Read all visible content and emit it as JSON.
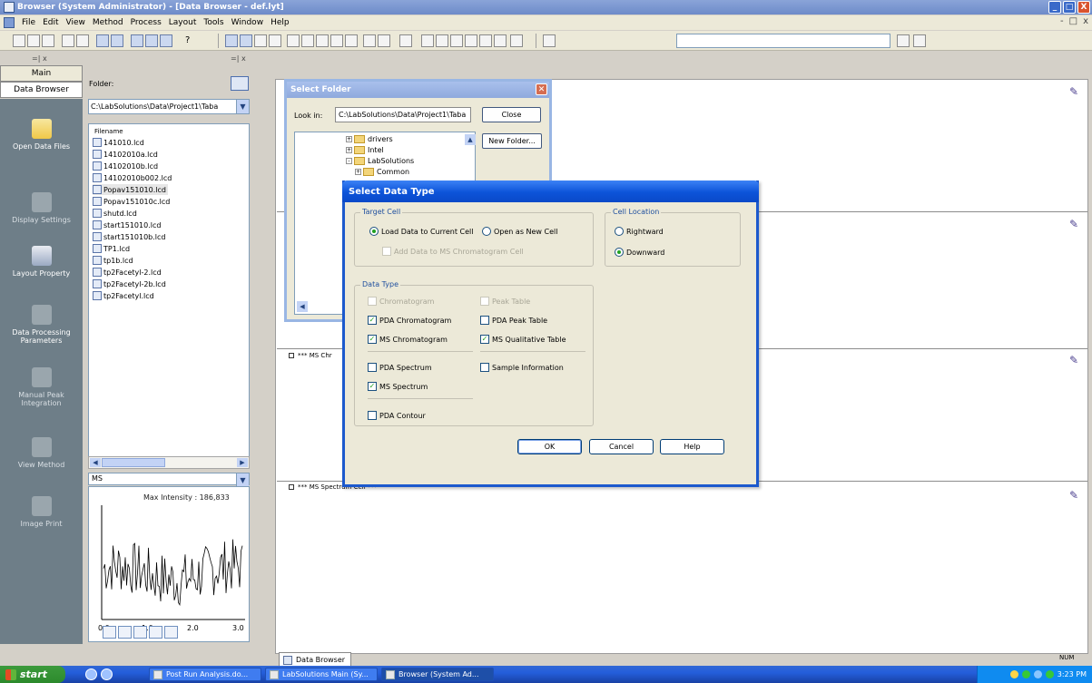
{
  "window": {
    "title": "Browser (System Administrator) - [Data Browser - def.lyt]",
    "controls": [
      "_",
      "□",
      "X"
    ]
  },
  "menubar": {
    "items": [
      "File",
      "Edit",
      "View",
      "Method",
      "Process",
      "Layout",
      "Tools",
      "Window",
      "Help"
    ],
    "mdi_controls": [
      "-",
      "□",
      "x"
    ]
  },
  "toolbar": {
    "help_glyph": "?"
  },
  "sidebar": {
    "header": "Main",
    "tab": "Data Browser",
    "items": [
      {
        "label": "Open Data Files",
        "icon": "folder-open-icon"
      },
      {
        "label": "Display Settings",
        "icon": "display-settings-icon"
      },
      {
        "label": "Layout Property",
        "icon": "layout-property-icon"
      },
      {
        "label": "Data Processing Parameters",
        "icon": "data-processing-icon"
      },
      {
        "label": "Manual Peak Integration",
        "icon": "peak-integration-icon"
      },
      {
        "label": "View Method",
        "icon": "view-method-icon"
      },
      {
        "label": "Image Print",
        "icon": "image-print-icon"
      }
    ]
  },
  "file_panel": {
    "folder_label": "Folder:",
    "folder_path": "C:\\LabSolutions\\Data\\Project1\\Taba",
    "list_header": "Filename",
    "files": [
      "141010.lcd",
      "14102010a.lcd",
      "14102010b.lcd",
      "14102010b002.lcd",
      "Popav151010.lcd",
      "Popav151010c.lcd",
      "shutd.lcd",
      "start151010.lcd",
      "start151010b.lcd",
      "TP1.lcd",
      "tp1b.lcd",
      "tp2Facetyl-2.lcd",
      "tp2Facetyl-2b.lcd",
      "tp2Facetyl.lcd"
    ],
    "selected_file": "Popav151010.lcd",
    "ms_selector": "MS",
    "plot": {
      "title": "Max Intensity : 186,833",
      "x_ticks": [
        "0.0",
        "1.0",
        "2.0",
        "3.0"
      ]
    }
  },
  "cells": {
    "chromatogram_title": "*** MS Chr",
    "spectrum_title": "*** MS Spectrum Cell ***"
  },
  "doc_tab": "Data Browser",
  "status": {
    "num": "NUM"
  },
  "select_folder": {
    "title": "Select Folder",
    "look_in_label": "Look in:",
    "look_in_path": "C:\\LabSolutions\\Data\\Project1\\Taba",
    "close_button": "Close",
    "new_folder_button": "New Folder...",
    "tree": [
      {
        "label": "drivers",
        "expander": "+"
      },
      {
        "label": "Intel",
        "expander": "+"
      },
      {
        "label": "LabSolutions",
        "expander": "-"
      },
      {
        "label": "Common",
        "expander": "+"
      }
    ]
  },
  "select_data_type": {
    "title": "Select Data Type",
    "target_cell": {
      "title": "Target Cell",
      "load_current": "Load Data to Current Cell",
      "open_new": "Open as New Cell",
      "add_ms": "Add Data to MS Chromatogram Cell"
    },
    "cell_location": {
      "title": "Cell Location",
      "rightward": "Rightward",
      "downward": "Downward"
    },
    "data_type": {
      "title": "Data Type",
      "chromatogram": "Chromatogram",
      "peak_table": "Peak Table",
      "pda_chromatogram": "PDA Chromatogram",
      "pda_peak_table": "PDA Peak Table",
      "ms_chromatogram": "MS Chromatogram",
      "ms_qualitative_table": "MS Qualitative Table",
      "pda_spectrum": "PDA Spectrum",
      "sample_information": "Sample Information",
      "ms_spectrum": "MS Spectrum",
      "pda_contour": "PDA Contour"
    },
    "ok": "OK",
    "cancel": "Cancel",
    "help": "Help"
  },
  "taskbar": {
    "start": "start",
    "tasks": [
      "Post Run Analysis.do...",
      "LabSolutions Main (Sy...",
      "Browser (System Ad..."
    ],
    "clock": "3:23 PM"
  },
  "colors": {
    "title_active": "#0c53d9",
    "sidebar_bg": "#6e7e88",
    "check_green": "#21a121"
  }
}
